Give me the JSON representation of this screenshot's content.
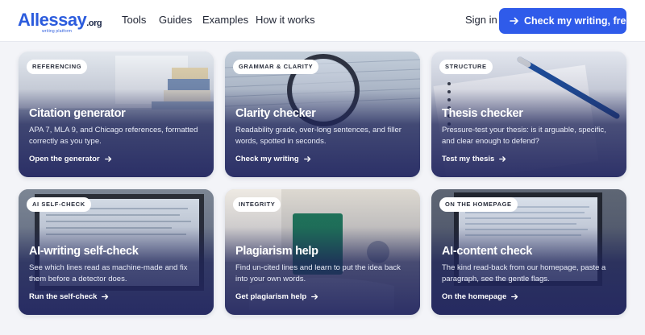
{
  "brand": {
    "logo_letter": "A",
    "logo_name": "llessay",
    "logo_tld": ".org",
    "tagline": "writing platform",
    "color": "#2c5cdd"
  },
  "nav": {
    "items": [
      {
        "label": "Tools"
      },
      {
        "label": "Guides"
      },
      {
        "label": "Examples"
      },
      {
        "label": "How it works"
      }
    ],
    "sign_in": "Sign in",
    "cta_label": "Check my writing, free",
    "cta_icon": "arrow-right-icon",
    "cta_color": "#2f5bea"
  },
  "cards": [
    {
      "badge": "REFERENCING",
      "title": "Citation generator",
      "desc": "APA 7, MLA 9, and Chicago references, formatted correctly as you type.",
      "link": "Open the generator",
      "image": "books-on-desk"
    },
    {
      "badge": "GRAMMAR & CLARITY",
      "title": "Clarity checker",
      "desc": "Readability grade, over-long sentences, and filler words, spotted in seconds.",
      "link": "Check my writing",
      "image": "magnifying-glass-on-paper"
    },
    {
      "badge": "STRUCTURE",
      "title": "Thesis checker",
      "desc": "Pressure-test your thesis: is it arguable, specific, and clear enough to defend?",
      "link": "Test my thesis",
      "image": "pen-on-notebook"
    },
    {
      "badge": "AI SELF-CHECK",
      "title": "AI-writing self-check",
      "desc": "See which lines read as machine-made and fix them before a detector does.",
      "link": "Run the self-check",
      "image": "laptop-with-document"
    },
    {
      "badge": "INTEGRITY",
      "title": "Plagiarism help",
      "desc": "Find un-cited lines and learn to put the idea back into your own words.",
      "link": "Get plagiarism help",
      "image": "open-book-and-green-book"
    },
    {
      "badge": "ON THE HOMEPAGE",
      "title": "AI-content check",
      "desc": "The kind read-back from our homepage, paste a paragraph, see the gentle flags.",
      "link": "On the homepage",
      "image": "laptop-screen-text"
    }
  ]
}
